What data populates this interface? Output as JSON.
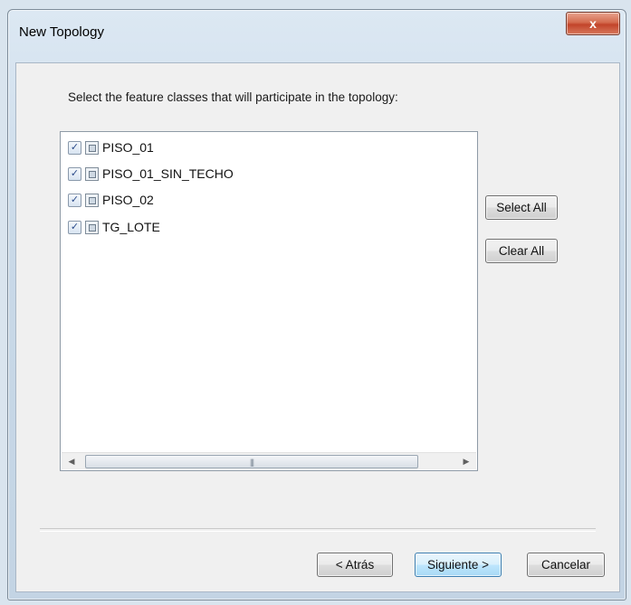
{
  "window": {
    "title": "New Topology",
    "close_label": "x"
  },
  "instruction": "Select the feature classes that will participate in the topology:",
  "feature_classes": [
    {
      "label": "PISO_01",
      "checked": true
    },
    {
      "label": "PISO_01_SIN_TECHO",
      "checked": true
    },
    {
      "label": "PISO_02",
      "checked": true
    },
    {
      "label": "TG_LOTE",
      "checked": true
    }
  ],
  "buttons": {
    "select_all": "Select All",
    "clear_all": "Clear All",
    "back": "< Atrás",
    "next": "Siguiente >",
    "cancel": "Cancelar"
  },
  "scrollbar": {
    "left_arrow": "◀",
    "right_arrow": "▶",
    "grip": "|||"
  },
  "checkmark": "✓"
}
